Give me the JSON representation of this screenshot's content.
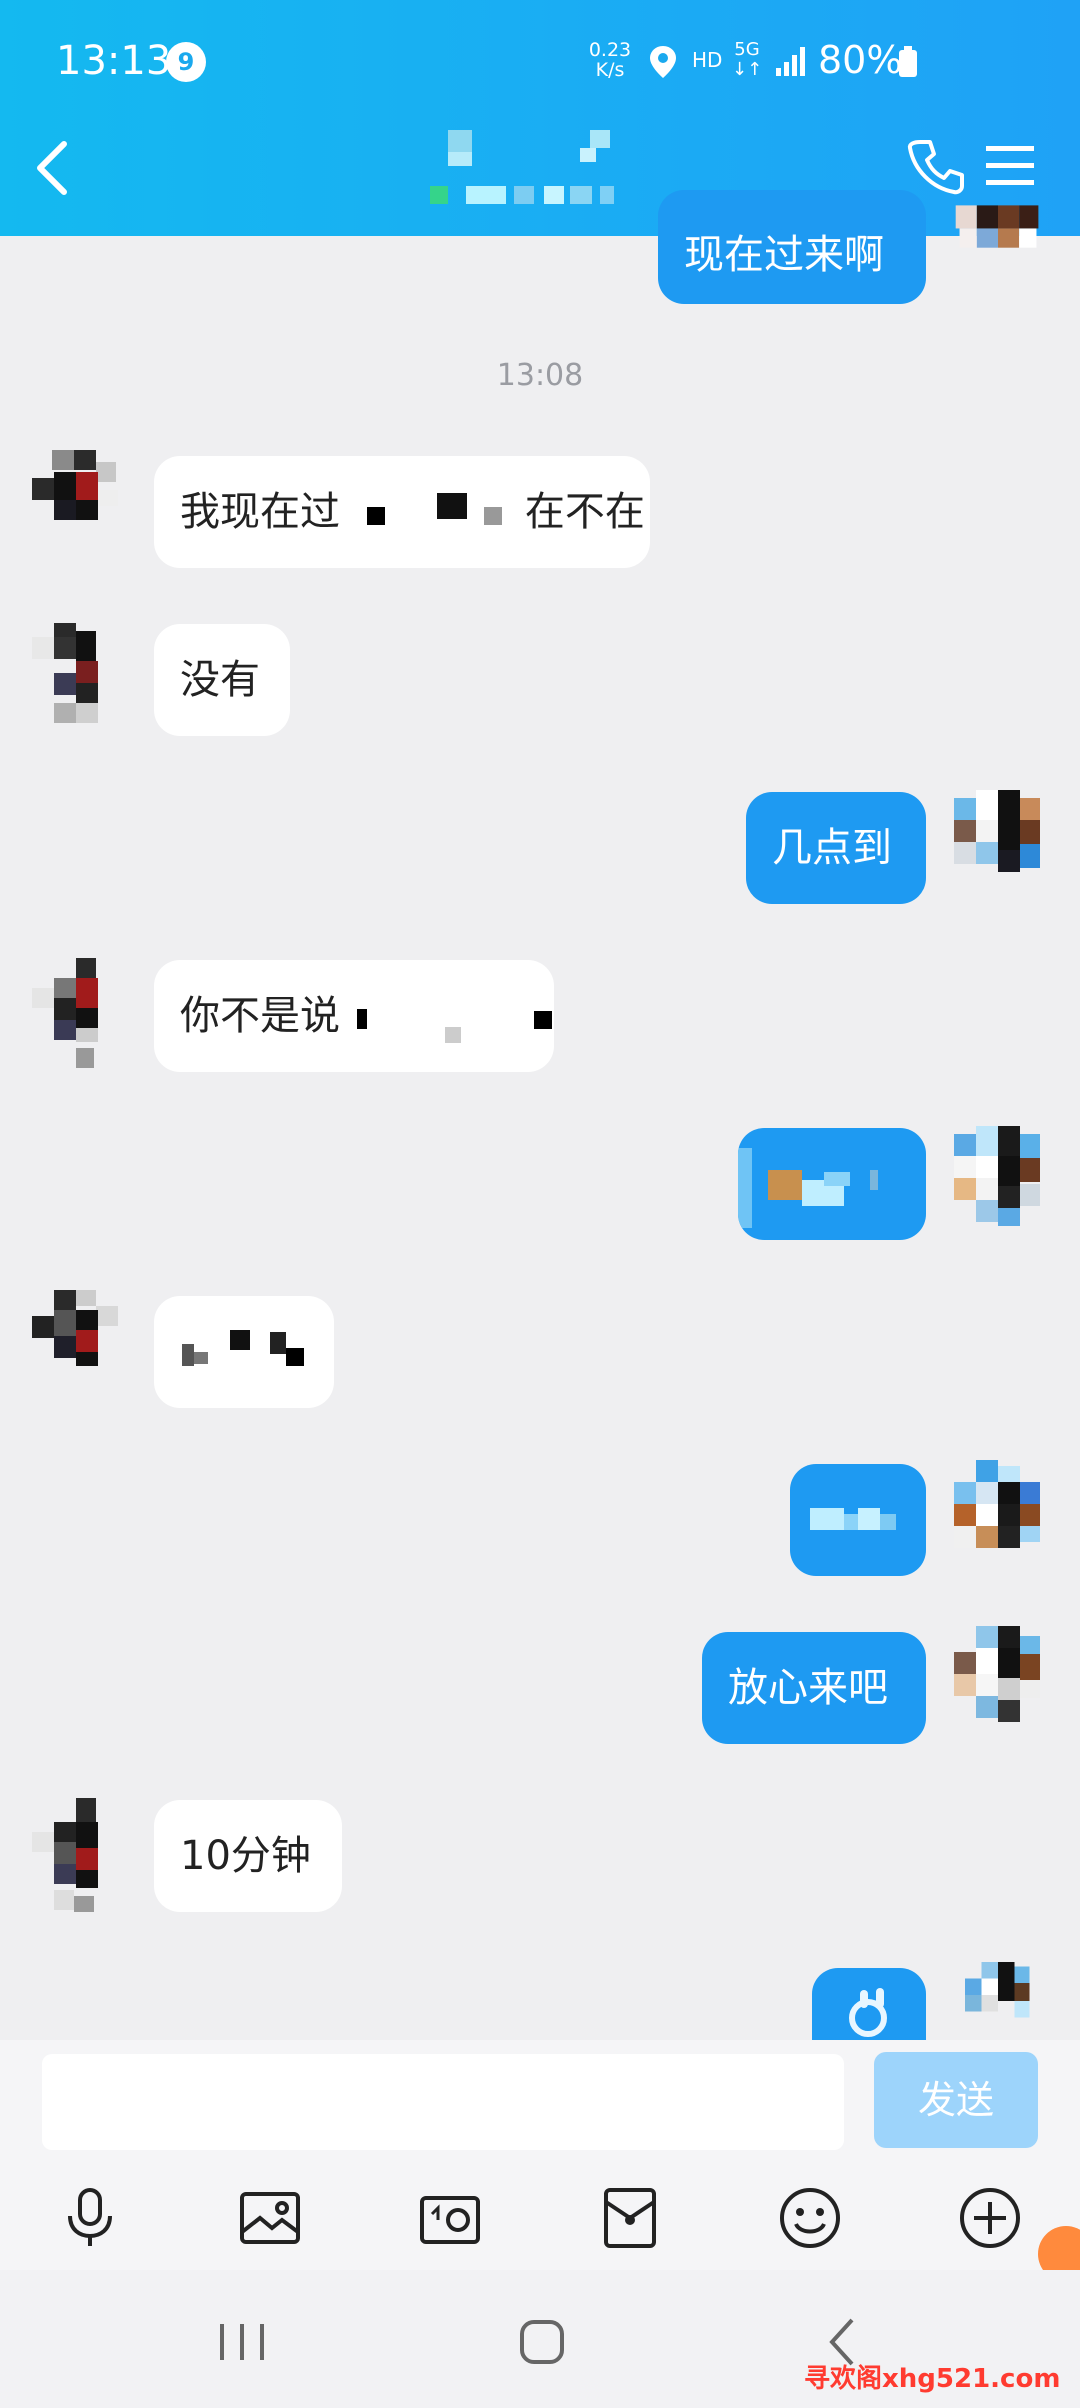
{
  "status_bar": {
    "time": "13:13",
    "notification_count": "9",
    "net_speed_top": "0.23",
    "net_speed_unit": "K/s",
    "hd_label": "HD",
    "network_label": "5G",
    "battery": "80%"
  },
  "header": {
    "back_icon": "chevron-left-icon",
    "call_icon": "phone-icon",
    "menu_icon": "menu-icon"
  },
  "messages": {
    "m0_text": "现在过来啊",
    "timestamp": "13:08",
    "m1_text_a": "我现在过",
    "m1_text_b": "在不在",
    "m2_text": "没有",
    "m3_text": "几点到",
    "m4_text": "你不是说",
    "m7_text": "放心来吧",
    "m8_text": "10分钟"
  },
  "input": {
    "placeholder": "",
    "send_label": "发送"
  },
  "toolbar": [
    "microphone-icon",
    "image-icon",
    "camera-icon",
    "red-packet-icon",
    "emoji-icon",
    "plus-icon"
  ],
  "nav": [
    "recent-apps-icon",
    "home-icon",
    "back-icon"
  ],
  "watermark": "寻欢阁xhg521.com",
  "colors": {
    "header": "#1aa9ee",
    "outgoing_bubble": "#1e9af2",
    "incoming_bubble": "#ffffff",
    "background": "#efeff1",
    "send_button": "#9dd4fb"
  }
}
